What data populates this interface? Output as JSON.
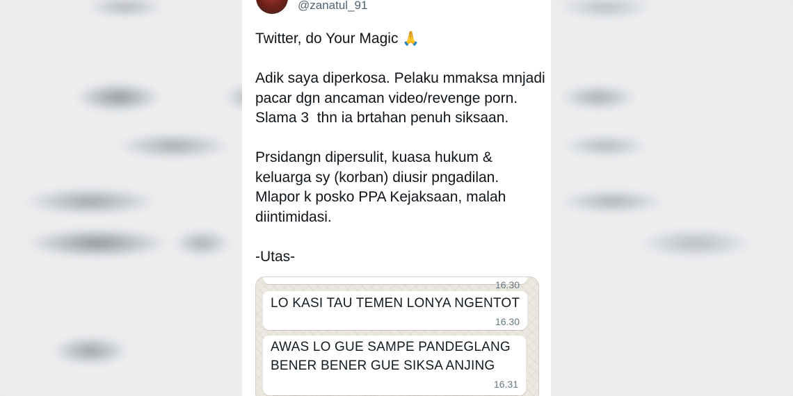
{
  "author": {
    "handle": "@zanatul_91",
    "avatar_icon": "profile-photo-avatar"
  },
  "tweet": {
    "paragraphs": [
      {
        "lines": [
          "Twitter, do Your Magic"
        ],
        "emoji": "🙏"
      },
      {
        "lines": [
          "Adik saya diperkosa. Pelaku mmaksa mnjadi",
          "pacar dgn ancaman video/revenge porn.",
          "Slama 3  thn ia brtahan penuh siksaan."
        ]
      },
      {
        "lines": [
          "Prsidangn dipersulit, kuasa hukum &",
          "keluarga sy (korban) diusir pngadilan.",
          "Mlapor k posko PPA Kejaksaan, malah",
          "diintimidasi."
        ]
      },
      {
        "lines": [
          "-Utas-"
        ]
      }
    ]
  },
  "chat_screenshot": {
    "messages": [
      {
        "text": "",
        "time": "16.30"
      },
      {
        "text": "LO KASI TAU TEMEN LONYA NGENTOT",
        "time": "16.30"
      },
      {
        "text": "AWAS LO GUE SAMPE PANDEGLANG\nBENER BENER GUE SIKSA ANJING",
        "time": "16.31"
      }
    ]
  },
  "colors": {
    "text_primary": "#0f1419",
    "text_secondary": "#536471",
    "chat_background": "#ece7e1",
    "bubble": "#ffffff",
    "bubble_time": "#667781"
  }
}
